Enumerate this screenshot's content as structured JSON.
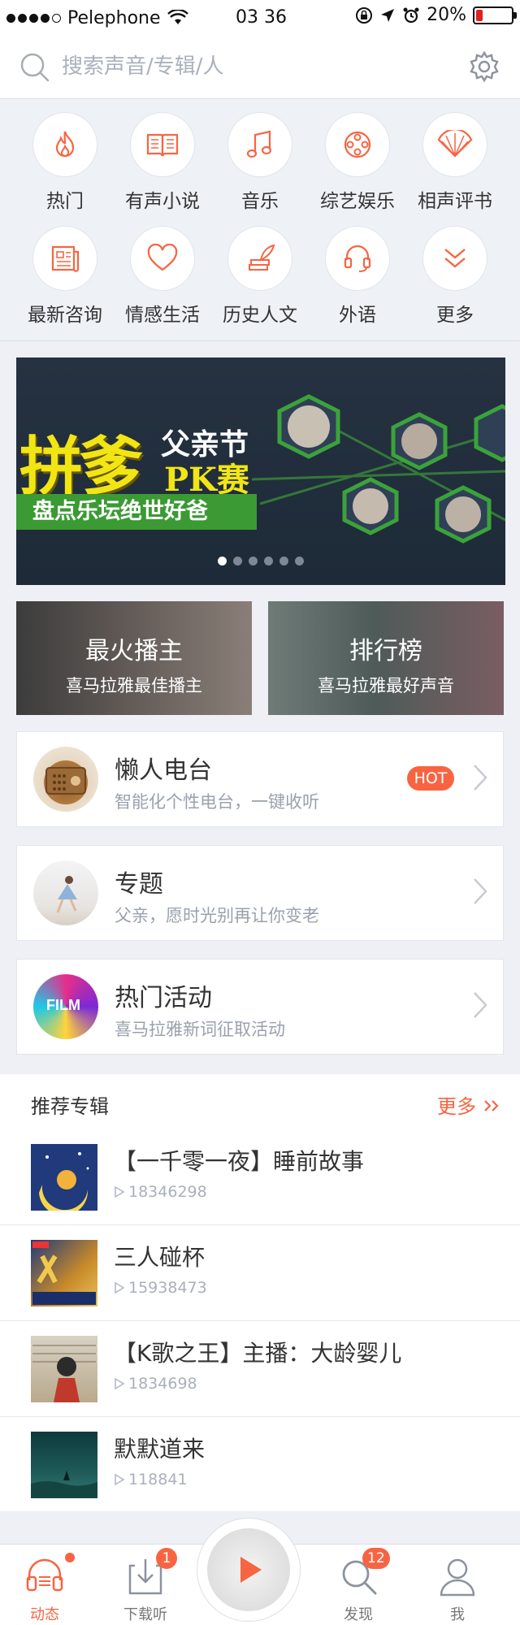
{
  "status": {
    "carrier": "Pelephone",
    "time": "03 36",
    "battery": "20%",
    "battery_level": 0.2
  },
  "search": {
    "placeholder": "搜索声音/专辑/人"
  },
  "categories": [
    {
      "label": "热门",
      "icon": "flame-icon"
    },
    {
      "label": "有声小说",
      "icon": "book-icon"
    },
    {
      "label": "音乐",
      "icon": "music-note-icon"
    },
    {
      "label": "综艺娱乐",
      "icon": "film-reel-icon"
    },
    {
      "label": "相声评书",
      "icon": "fan-icon"
    },
    {
      "label": "最新咨询",
      "icon": "newspaper-icon"
    },
    {
      "label": "情感生活",
      "icon": "heart-icon"
    },
    {
      "label": "历史人文",
      "icon": "quill-books-icon"
    },
    {
      "label": "外语",
      "icon": "headset-icon"
    },
    {
      "label": "更多",
      "icon": "chevron-down-icon"
    }
  ],
  "banner": {
    "big": "拼爹",
    "line1": "父亲节",
    "line2": "PK赛",
    "ribbon": "盘点乐坛绝世好爸",
    "page_count": 6,
    "active_index": 0
  },
  "tiles": [
    {
      "title": "最火播主",
      "subtitle": "喜马拉雅最佳播主"
    },
    {
      "title": "排行榜",
      "subtitle": "喜马拉雅最好声音"
    }
  ],
  "cards": [
    {
      "title": "懒人电台",
      "subtitle": "智能化个性电台，一键收听",
      "badge": "HOT"
    },
    {
      "title": "专题",
      "subtitle": "父亲，愿时光别再让你变老"
    },
    {
      "title": "热门活动",
      "subtitle": "喜马拉雅新词征取活动",
      "thumb_text": "FILM"
    }
  ],
  "recommend": {
    "heading": "推荐专辑",
    "more": "更多",
    "albums": [
      {
        "title": "【一千零一夜】睡前故事",
        "plays": "18346298"
      },
      {
        "title": "三人碰杯",
        "plays": "15938473"
      },
      {
        "title": "【K歌之王】主播：大龄婴儿",
        "plays": "1834698"
      },
      {
        "title": "默默道来",
        "plays": "118841"
      }
    ]
  },
  "tabbar": {
    "tabs": [
      {
        "label": "动态",
        "icon": "headphones-icon"
      },
      {
        "label": "下载听",
        "icon": "download-icon",
        "badge": "1"
      },
      {
        "label": "发现",
        "icon": "search-icon",
        "badge": "12"
      },
      {
        "label": "我",
        "icon": "person-icon"
      }
    ]
  },
  "colors": {
    "accent": "#f86442",
    "background": "#eef0f5"
  }
}
